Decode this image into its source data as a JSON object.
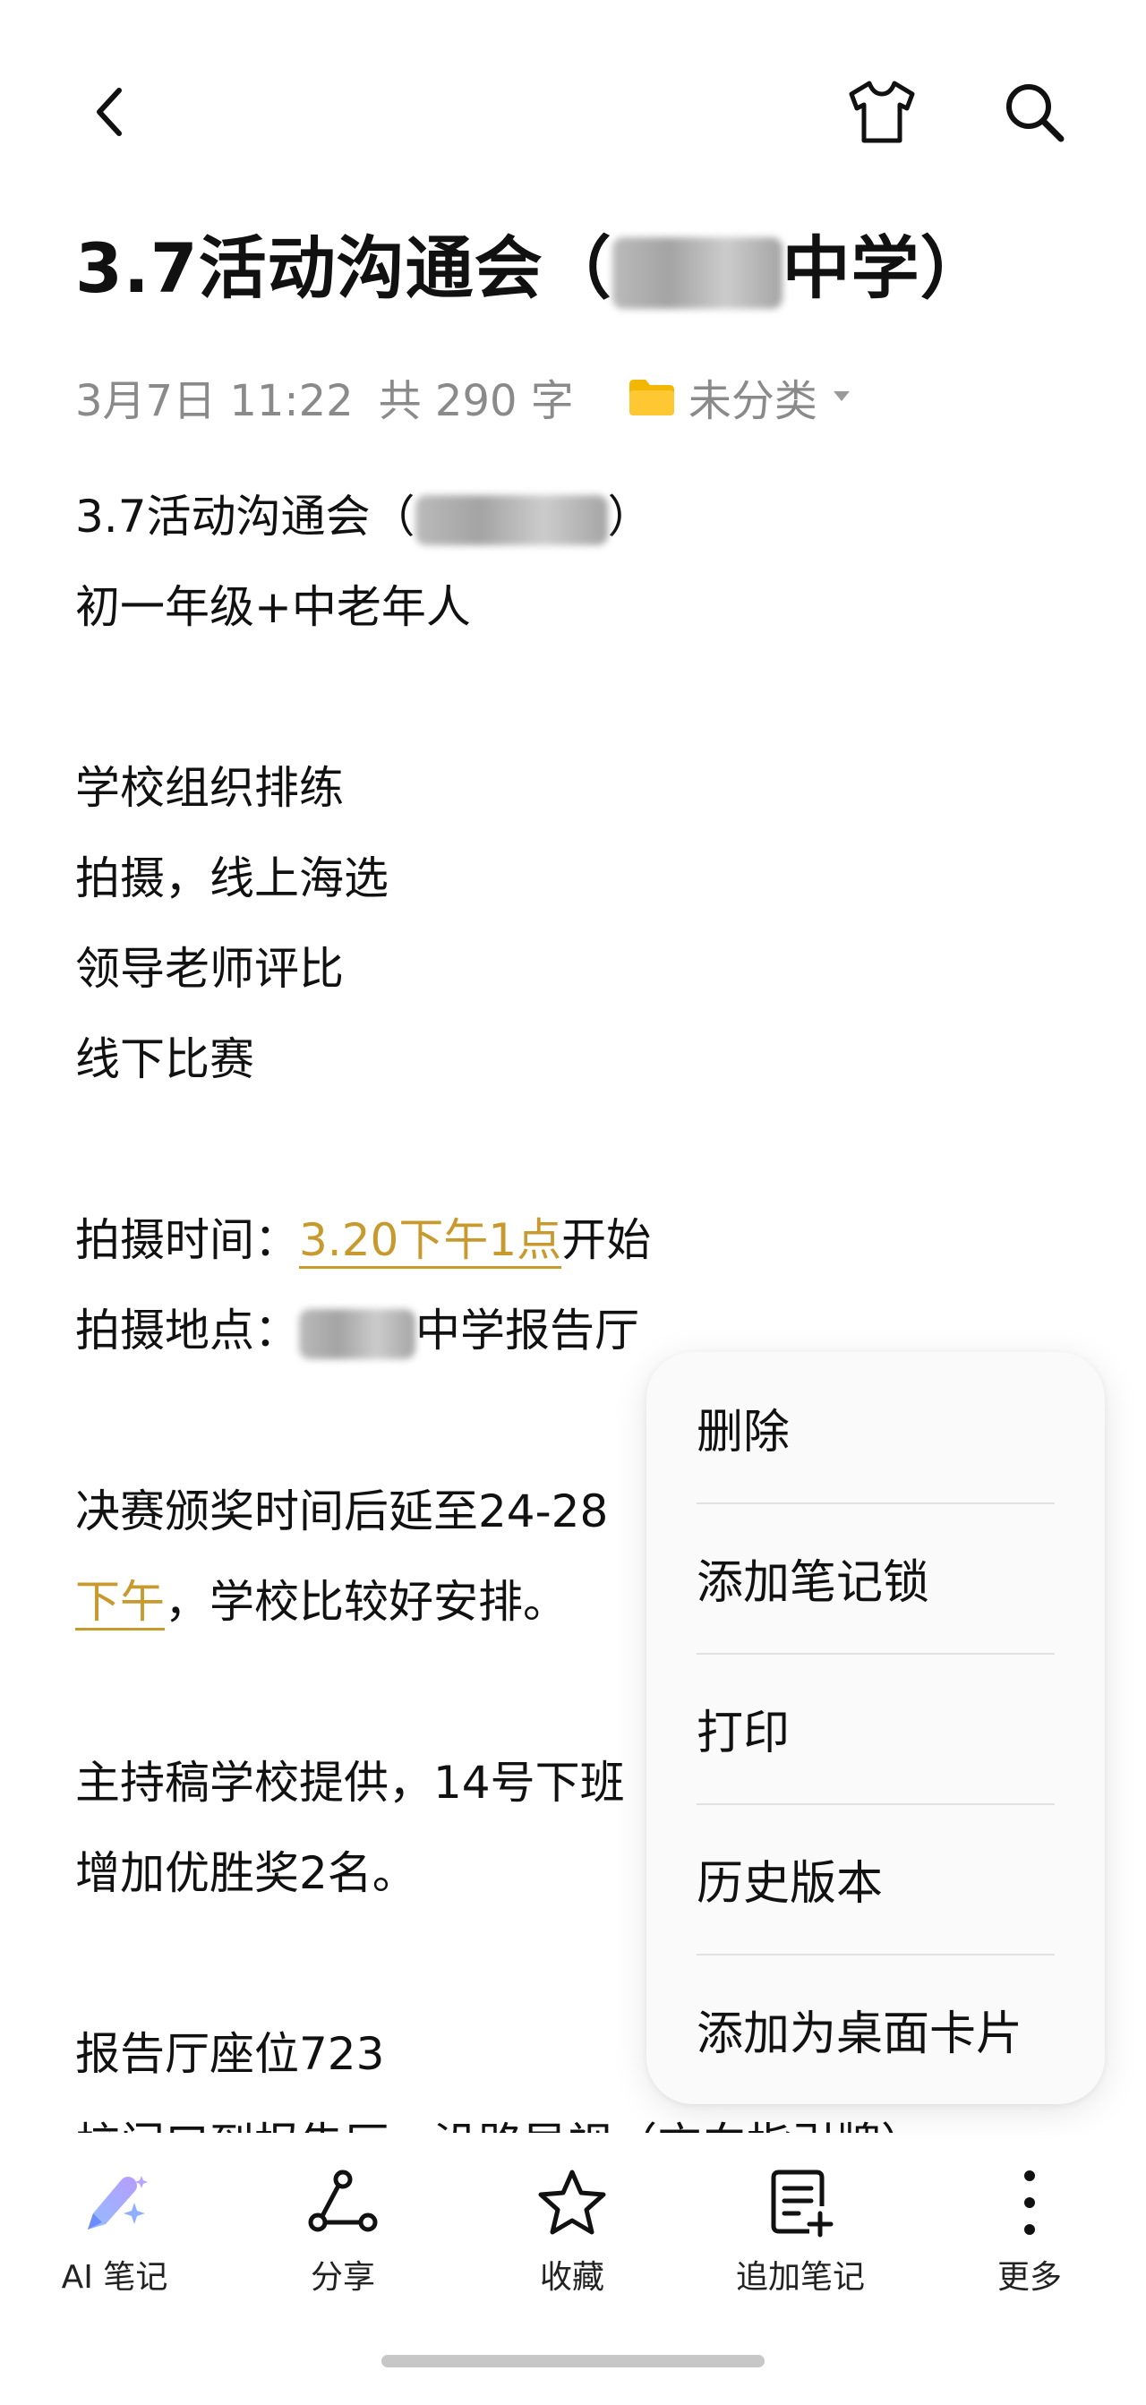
{
  "note": {
    "title_prefix": "3.7活动沟通会（",
    "title_suffix": "中学）",
    "meta_date": "3月7日 11:22",
    "meta_count": "共 290 字",
    "folder": "未分类",
    "lines": [
      {
        "text": "3.7活动沟通会（",
        "after": "）"
      },
      {
        "text": "初一年级+中老年人"
      },
      {
        "text": ""
      },
      {
        "text": "学校组织排练"
      },
      {
        "text": "拍摄，线上海选"
      },
      {
        "text": "领导老师评比"
      },
      {
        "text": "线下比赛"
      },
      {
        "text": ""
      },
      {
        "text": "拍摄时间：",
        "highlight": "3.20下午1点",
        "after": "开始"
      },
      {
        "text": "拍摄地点：",
        "after": "中学报告厅"
      },
      {
        "text": ""
      },
      {
        "text": "决赛颁奖时间后延至24-28"
      },
      {
        "text": "",
        "highlight": "下午",
        "after": "，学校比较好安排。"
      },
      {
        "text": ""
      },
      {
        "text": "主持稿学校提供，14号下班"
      },
      {
        "text": "增加优胜奖2名。"
      },
      {
        "text": ""
      },
      {
        "text": "报告厅座位723"
      },
      {
        "text": "校门口到报告厅，沿路导视（方向指引牌）"
      }
    ]
  },
  "menu": {
    "items": [
      "删除",
      "添加笔记锁",
      "打印",
      "历史版本",
      "添加为桌面卡片"
    ]
  },
  "toolbar": {
    "ai_label": "AI 笔记",
    "share_label": "分享",
    "favorite_label": "收藏",
    "append_label": "追加笔记",
    "more_label": "更多"
  },
  "colors": {
    "highlight": "#c89a2e",
    "folder": "#f2b705",
    "meta_text": "#8a8a8a",
    "ai_gradient": [
      "#7fb2ff",
      "#a98bff"
    ]
  },
  "icons": {
    "back": "chevron-left-icon",
    "theme": "tshirt-icon",
    "search": "search-icon",
    "folder": "folder-icon",
    "ai": "pen-sparkle-icon",
    "share": "share-icon",
    "favorite": "star-icon",
    "append": "note-add-icon",
    "more": "more-vertical-icon"
  }
}
